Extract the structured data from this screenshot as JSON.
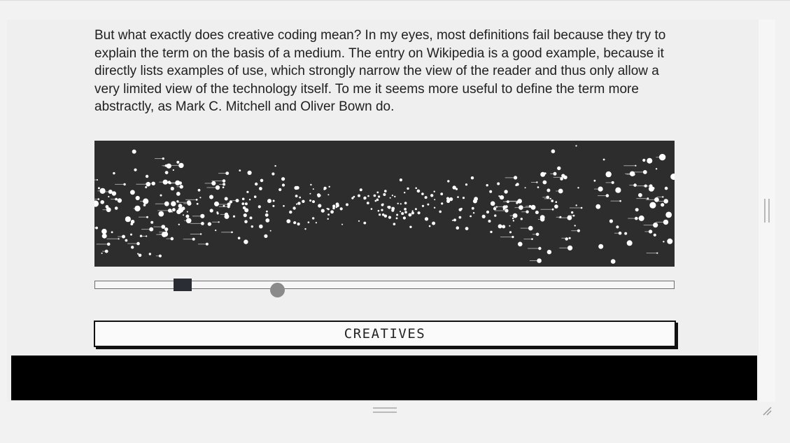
{
  "article": {
    "paragraph": "But what exactly does creative coding mean? In my eyes, most definitions fail because they try to explain the term on the basis of a medium. The entry on Wikipedia is a good example, because it directly lists examples of use, which strongly narrow the view of the reader and thus only allow a very limited view of the technology itself. To me it seems more useful to define the term more abstractly, as Mark C. Mitchell and Oliver Bown do."
  },
  "visualization": {
    "background_color": "#2d2d2d",
    "particle_color": "#ffffff"
  },
  "slider": {
    "square_handle_value": 0.15,
    "circle_handle_value": 0.32
  },
  "button": {
    "label": "CREATIVES"
  },
  "icons": {
    "scrollbar_grip": "vertical-grip-icon",
    "bottom_grip": "horizontal-grip-icon",
    "resize": "resize-handle-icon"
  }
}
